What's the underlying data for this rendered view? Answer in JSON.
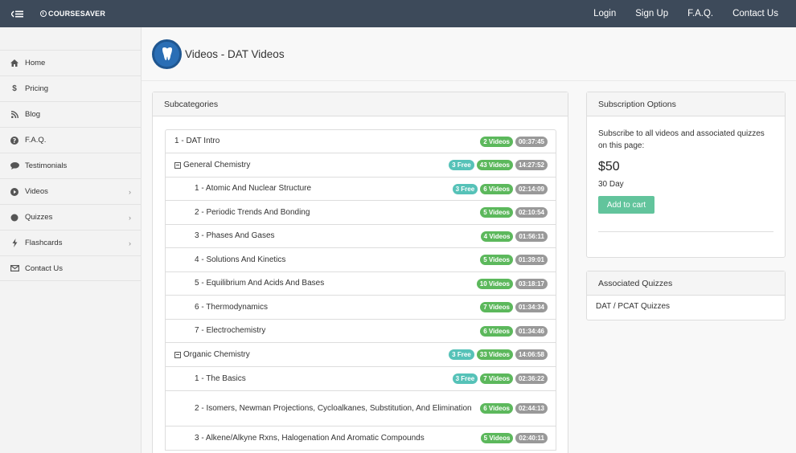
{
  "navbar": {
    "brand": "COURSESAVER",
    "links": [
      "Login",
      "Sign Up",
      "F.A.Q.",
      "Contact Us"
    ]
  },
  "sidebar": {
    "items": [
      {
        "label": "Home",
        "icon": "home-icon"
      },
      {
        "label": "Pricing",
        "icon": "dollar-icon"
      },
      {
        "label": "Blog",
        "icon": "rss-icon"
      },
      {
        "label": "F.A.Q.",
        "icon": "question-circle-icon"
      },
      {
        "label": "Testimonials",
        "icon": "comment-icon"
      },
      {
        "label": "Videos",
        "icon": "play-circle-icon",
        "chevron": true
      },
      {
        "label": "Quizzes",
        "icon": "circle-icon",
        "chevron": true
      },
      {
        "label": "Flashcards",
        "icon": "bolt-icon",
        "chevron": true
      },
      {
        "label": "Contact Us",
        "icon": "envelope-icon"
      }
    ]
  },
  "header": {
    "title": "Videos - DAT Videos"
  },
  "subcategories": {
    "heading": "Subcategories",
    "rows": [
      {
        "label": "1 - DAT Intro",
        "type": "item",
        "videos": "2 Videos",
        "time": "00:37:45"
      },
      {
        "label": "General Chemistry",
        "type": "category",
        "free": "3 Free",
        "videos": "43 Videos",
        "time": "14:27:52"
      },
      {
        "label": "1 - Atomic And Nuclear Structure",
        "type": "child",
        "free": "3 Free",
        "videos": "6 Videos",
        "time": "02:14:09"
      },
      {
        "label": "2 - Periodic Trends And Bonding",
        "type": "child",
        "videos": "5 Videos",
        "time": "02:10:54"
      },
      {
        "label": "3 - Phases And Gases",
        "type": "child",
        "videos": "4 Videos",
        "time": "01:56:11"
      },
      {
        "label": "4 - Solutions And Kinetics",
        "type": "child",
        "videos": "5 Videos",
        "time": "01:39:01"
      },
      {
        "label": "5 - Equilibrium And Acids And Bases",
        "type": "child",
        "videos": "10 Videos",
        "time": "03:18:17"
      },
      {
        "label": "6 - Thermodynamics",
        "type": "child",
        "videos": "7 Videos",
        "time": "01:34:34"
      },
      {
        "label": "7 - Electrochemistry",
        "type": "child",
        "videos": "6 Videos",
        "time": "01:34:46"
      },
      {
        "label": "Organic Chemistry",
        "type": "category",
        "free": "3 Free",
        "videos": "33 Videos",
        "time": "14:06:58"
      },
      {
        "label": "1 - The Basics",
        "type": "child",
        "free": "3 Free",
        "videos": "7 Videos",
        "time": "02:36:22"
      },
      {
        "label": "2 - Isomers, Newman Projections, Cycloalkanes, Substitution, And Elimination",
        "type": "child",
        "videos": "6 Videos",
        "time": "02:44:13"
      },
      {
        "label": "3 - Alkene/Alkyne Rxns, Halogenation And Aromatic Compounds",
        "type": "child",
        "videos": "5 Videos",
        "time": "02:40:11"
      }
    ]
  },
  "subscription": {
    "heading": "Subscription Options",
    "text": "Subscribe to all videos and associated quizzes on this page:",
    "price": "$50",
    "term": "30 Day",
    "button": "Add to cart"
  },
  "quizzes": {
    "heading": "Associated Quizzes",
    "items": [
      "DAT / PCAT Quizzes"
    ]
  },
  "colors": {
    "navbar": "#3d4a5a",
    "free_badge": "#56c2b8",
    "videos_badge": "#5cb85c",
    "time_badge": "#999999",
    "cart_button": "#62c49c"
  }
}
